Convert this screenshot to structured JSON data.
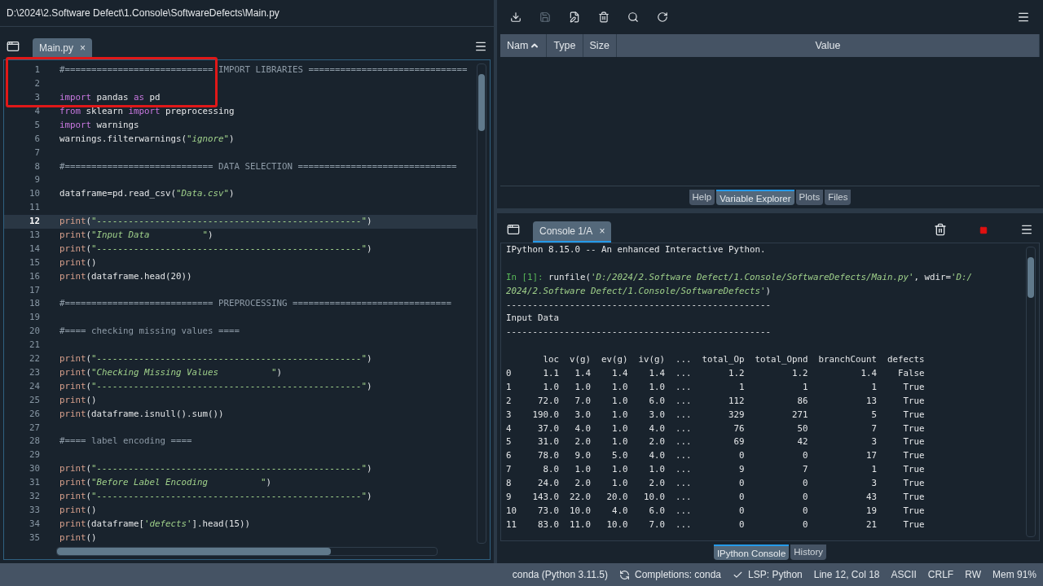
{
  "window": {
    "title": "D:\\2024\\2.Software Defect\\1.Console\\SoftwareDefects\\Main.py"
  },
  "editor": {
    "tabs": [
      {
        "label": "Main.py",
        "close": "×",
        "selected": true
      }
    ],
    "annotation": {
      "kind": "highlight-box",
      "color": "#e01818"
    },
    "lines": [
      {
        "number": "1",
        "current": false,
        "segments": [
          {
            "text": "#============================ IMPORT LIBRARIES ==============================",
            "kind": "comment"
          }
        ]
      },
      {
        "number": "2",
        "current": false
      },
      {
        "number": "3",
        "current": false,
        "segments": [
          {
            "text": "import",
            "kind": "keyword"
          },
          {
            "text": " pandas ",
            "kind": "plain"
          },
          {
            "text": "as",
            "kind": "keyword"
          },
          {
            "text": " pd",
            "kind": "plain"
          }
        ]
      },
      {
        "number": "4",
        "current": false,
        "segments": [
          {
            "text": "from",
            "kind": "keyword"
          },
          {
            "text": " sklearn ",
            "kind": "plain"
          },
          {
            "text": "import",
            "kind": "keyword"
          },
          {
            "text": " preprocessing",
            "kind": "plain"
          }
        ]
      },
      {
        "number": "5",
        "current": false,
        "segments": [
          {
            "text": "import",
            "kind": "keyword"
          },
          {
            "text": " warnings",
            "kind": "plain"
          }
        ]
      },
      {
        "number": "6",
        "current": false,
        "segments": [
          {
            "text": "warnings.filterwarnings(",
            "kind": "plain"
          },
          {
            "text": "\"ignore\"",
            "kind": "string"
          },
          {
            "text": ")",
            "kind": "plain"
          }
        ]
      },
      {
        "number": "7",
        "current": false
      },
      {
        "number": "8",
        "current": false,
        "segments": [
          {
            "text": "#============================ DATA SELECTION ==============================",
            "kind": "comment"
          }
        ]
      },
      {
        "number": "9",
        "current": false
      },
      {
        "number": "10",
        "current": false,
        "segments": [
          {
            "text": "dataframe=pd.read_csv(",
            "kind": "plain"
          },
          {
            "text": "\"Data.csv\"",
            "kind": "string"
          },
          {
            "text": ")",
            "kind": "plain"
          }
        ]
      },
      {
        "number": "11",
        "current": false
      },
      {
        "number": "12",
        "current": true,
        "segments": [
          {
            "text": "print",
            "kind": "builtin"
          },
          {
            "text": "(",
            "kind": "plain"
          },
          {
            "text": "\"--------------------------------------------------\"",
            "kind": "string"
          },
          {
            "text": ")",
            "kind": "plain"
          }
        ]
      },
      {
        "number": "13",
        "current": false,
        "segments": [
          {
            "text": "print",
            "kind": "builtin"
          },
          {
            "text": "(",
            "kind": "plain"
          },
          {
            "text": "\"Input Data          \"",
            "kind": "string"
          },
          {
            "text": ")",
            "kind": "plain"
          }
        ]
      },
      {
        "number": "14",
        "current": false,
        "segments": [
          {
            "text": "print",
            "kind": "builtin"
          },
          {
            "text": "(",
            "kind": "plain"
          },
          {
            "text": "\"--------------------------------------------------\"",
            "kind": "string"
          },
          {
            "text": ")",
            "kind": "plain"
          }
        ]
      },
      {
        "number": "15",
        "current": false,
        "segments": [
          {
            "text": "print",
            "kind": "builtin"
          },
          {
            "text": "()",
            "kind": "plain"
          }
        ]
      },
      {
        "number": "16",
        "current": false,
        "segments": [
          {
            "text": "print",
            "kind": "builtin"
          },
          {
            "text": "(dataframe.head(20))",
            "kind": "plain"
          }
        ]
      },
      {
        "number": "17",
        "current": false
      },
      {
        "number": "18",
        "current": false,
        "segments": [
          {
            "text": "#============================ PREPROCESSING ==============================",
            "kind": "comment"
          }
        ]
      },
      {
        "number": "19",
        "current": false
      },
      {
        "number": "20",
        "current": false,
        "segments": [
          {
            "text": "#==== checking missing values ====",
            "kind": "comment"
          }
        ]
      },
      {
        "number": "21",
        "current": false
      },
      {
        "number": "22",
        "current": false,
        "segments": [
          {
            "text": "print",
            "kind": "builtin"
          },
          {
            "text": "(",
            "kind": "plain"
          },
          {
            "text": "\"--------------------------------------------------\"",
            "kind": "string"
          },
          {
            "text": ")",
            "kind": "plain"
          }
        ]
      },
      {
        "number": "23",
        "current": false,
        "segments": [
          {
            "text": "print",
            "kind": "builtin"
          },
          {
            "text": "(",
            "kind": "plain"
          },
          {
            "text": "\"Checking Missing Values          \"",
            "kind": "string"
          },
          {
            "text": ")",
            "kind": "plain"
          }
        ]
      },
      {
        "number": "24",
        "current": false,
        "segments": [
          {
            "text": "print",
            "kind": "builtin"
          },
          {
            "text": "(",
            "kind": "plain"
          },
          {
            "text": "\"--------------------------------------------------\"",
            "kind": "string"
          },
          {
            "text": ")",
            "kind": "plain"
          }
        ]
      },
      {
        "number": "25",
        "current": false,
        "segments": [
          {
            "text": "print",
            "kind": "builtin"
          },
          {
            "text": "()",
            "kind": "plain"
          }
        ]
      },
      {
        "number": "26",
        "current": false,
        "segments": [
          {
            "text": "print",
            "kind": "builtin"
          },
          {
            "text": "(dataframe.isnull().sum())",
            "kind": "plain"
          }
        ]
      },
      {
        "number": "27",
        "current": false
      },
      {
        "number": "28",
        "current": false,
        "segments": [
          {
            "text": "#==== label encoding ====",
            "kind": "comment"
          }
        ]
      },
      {
        "number": "29",
        "current": false
      },
      {
        "number": "30",
        "current": false,
        "segments": [
          {
            "text": "print",
            "kind": "builtin"
          },
          {
            "text": "(",
            "kind": "plain"
          },
          {
            "text": "\"--------------------------------------------------\"",
            "kind": "string"
          },
          {
            "text": ")",
            "kind": "plain"
          }
        ]
      },
      {
        "number": "31",
        "current": false,
        "segments": [
          {
            "text": "print",
            "kind": "builtin"
          },
          {
            "text": "(",
            "kind": "plain"
          },
          {
            "text": "\"Before Label Encoding          \"",
            "kind": "string"
          },
          {
            "text": ")",
            "kind": "plain"
          }
        ]
      },
      {
        "number": "32",
        "current": false,
        "segments": [
          {
            "text": "print",
            "kind": "builtin"
          },
          {
            "text": "(",
            "kind": "plain"
          },
          {
            "text": "\"--------------------------------------------------\"",
            "kind": "string"
          },
          {
            "text": ")",
            "kind": "plain"
          }
        ]
      },
      {
        "number": "33",
        "current": false,
        "segments": [
          {
            "text": "print",
            "kind": "builtin"
          },
          {
            "text": "()",
            "kind": "plain"
          }
        ]
      },
      {
        "number": "34",
        "current": false,
        "segments": [
          {
            "text": "print",
            "kind": "builtin"
          },
          {
            "text": "(dataframe[",
            "kind": "plain"
          },
          {
            "text": "'defects'",
            "kind": "string"
          },
          {
            "text": "].head(15))",
            "kind": "plain"
          }
        ]
      },
      {
        "number": "35",
        "current": false,
        "segments": [
          {
            "text": "print",
            "kind": "builtin"
          },
          {
            "text": "()",
            "kind": "plain"
          }
        ]
      }
    ]
  },
  "variable_explorer": {
    "toolbar": [
      {
        "kind": "import",
        "disabled": false
      },
      {
        "kind": "save",
        "disabled": true
      },
      {
        "kind": "save-as",
        "disabled": false
      },
      {
        "kind": "remove",
        "disabled": false
      },
      {
        "kind": "search",
        "disabled": false
      },
      {
        "kind": "refresh",
        "disabled": false
      }
    ],
    "columns": [
      {
        "label": "Nam",
        "sorted": true
      },
      {
        "label": "Type",
        "sorted": false
      },
      {
        "label": "Size",
        "sorted": false
      },
      {
        "label": "Value",
        "sorted": false
      }
    ]
  },
  "top_tabs": [
    {
      "label": "Help",
      "selected": false
    },
    {
      "label": "Variable Explorer",
      "selected": true
    },
    {
      "label": "Plots",
      "selected": false
    },
    {
      "label": "Files",
      "selected": false
    }
  ],
  "console": {
    "tabs": [
      {
        "label": "Console 1/A",
        "close": "×",
        "selected": true
      }
    ],
    "lines": [
      {
        "segments": [
          {
            "text": "IPython 8.15.0 -- An enhanced Interactive Python.",
            "kind": "plain"
          }
        ]
      },
      {
        "kind": "blank"
      },
      {
        "segments": [
          {
            "text": "In [1]: ",
            "kind": "prompt"
          },
          {
            "text": "runfile(",
            "kind": "plain"
          },
          {
            "text": "'D:/2024/2.Software Defect/1.Console/SoftwareDefects/Main.py'",
            "kind": "string"
          },
          {
            "text": ", wdir=",
            "kind": "plain"
          },
          {
            "text": "'D:/",
            "kind": "string"
          }
        ]
      },
      {
        "segments": [
          {
            "text": "2024/2.Software Defect/1.Console/SoftwareDefects'",
            "kind": "string"
          },
          {
            "text": ")",
            "kind": "plain"
          }
        ]
      },
      {
        "segments": [
          {
            "text": "--------------------------------------------------",
            "kind": "plain"
          }
        ]
      },
      {
        "segments": [
          {
            "text": "Input Data",
            "kind": "plain"
          }
        ]
      },
      {
        "segments": [
          {
            "text": "--------------------------------------------------",
            "kind": "plain"
          }
        ]
      },
      {
        "kind": "blank"
      },
      {
        "segments": [
          {
            "text": "       loc  v(g)  ev(g)  iv(g)  ...  total_Op  total_Opnd  branchCount  defects",
            "kind": "plain"
          }
        ]
      },
      {
        "segments": [
          {
            "text": "0      1.1   1.4    1.4    1.4  ...       1.2         1.2          1.4    False",
            "kind": "plain"
          }
        ]
      },
      {
        "segments": [
          {
            "text": "1      1.0   1.0    1.0    1.0  ...         1           1            1     True",
            "kind": "plain"
          }
        ]
      },
      {
        "segments": [
          {
            "text": "2     72.0   7.0    1.0    6.0  ...       112          86           13     True",
            "kind": "plain"
          }
        ]
      },
      {
        "segments": [
          {
            "text": "3    190.0   3.0    1.0    3.0  ...       329         271            5     True",
            "kind": "plain"
          }
        ]
      },
      {
        "segments": [
          {
            "text": "4     37.0   4.0    1.0    4.0  ...        76          50            7     True",
            "kind": "plain"
          }
        ]
      },
      {
        "segments": [
          {
            "text": "5     31.0   2.0    1.0    2.0  ...        69          42            3     True",
            "kind": "plain"
          }
        ]
      },
      {
        "segments": [
          {
            "text": "6     78.0   9.0    5.0    4.0  ...         0           0           17     True",
            "kind": "plain"
          }
        ]
      },
      {
        "segments": [
          {
            "text": "7      8.0   1.0    1.0    1.0  ...         9           7            1     True",
            "kind": "plain"
          }
        ]
      },
      {
        "segments": [
          {
            "text": "8     24.0   2.0    1.0    2.0  ...         0           0            3     True",
            "kind": "plain"
          }
        ]
      },
      {
        "segments": [
          {
            "text": "9    143.0  22.0   20.0   10.0  ...         0           0           43     True",
            "kind": "plain"
          }
        ]
      },
      {
        "segments": [
          {
            "text": "10    73.0  10.0    4.0    6.0  ...         0           0           19     True",
            "kind": "plain"
          }
        ]
      },
      {
        "segments": [
          {
            "text": "11    83.0  11.0   10.0    7.0  ...         0           0           21     True",
            "kind": "plain"
          }
        ]
      }
    ]
  },
  "bottom_tabs": [
    {
      "label": "IPython Console",
      "selected": true
    },
    {
      "label": "History",
      "selected": false
    }
  ],
  "status_bar": [
    {
      "kind": "plain",
      "text": "conda (Python 3.11.5)"
    },
    {
      "kind": "sync",
      "text": "Completions: conda"
    },
    {
      "kind": "check",
      "text": "LSP: Python"
    },
    {
      "kind": "plain",
      "text": "Line 12, Col 18"
    },
    {
      "kind": "plain",
      "text": "ASCII"
    },
    {
      "kind": "plain",
      "text": "CRLF"
    },
    {
      "kind": "plain",
      "text": "RW"
    },
    {
      "kind": "plain",
      "text": "Mem 91%"
    }
  ]
}
